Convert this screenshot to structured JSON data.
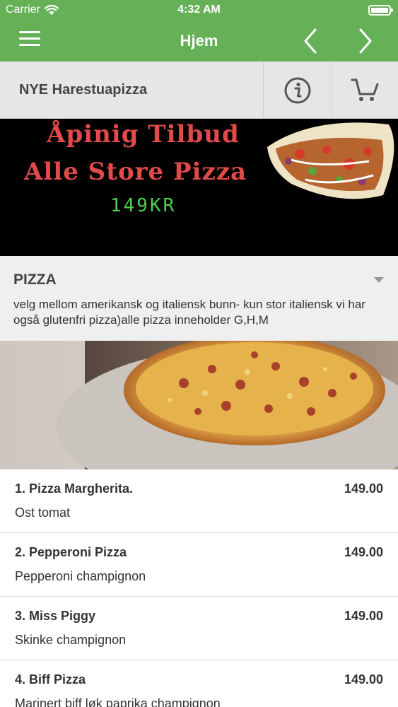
{
  "status_bar": {
    "carrier": "Carrier",
    "time": "4:32 AM"
  },
  "navbar": {
    "title": "Hjem"
  },
  "restaurant": {
    "name": "NYE Harestuapizza"
  },
  "banner": {
    "line1": "Åpinig Tilbud",
    "line2": "Alle Store Pizza",
    "price": "149KR"
  },
  "category": {
    "title": "PIZZA",
    "description": "velg mellom amerikansk og italiensk bunn- kun stor italiensk vi har også glutenfri pizza)alle pizza inneholder G,H,M"
  },
  "menu_items": [
    {
      "name": "1. Pizza Margherita.",
      "price": "149.00",
      "description": "Ost tomat"
    },
    {
      "name": "2. Pepperoni Pizza",
      "price": "149.00",
      "description": "Pepperoni champignon"
    },
    {
      "name": "3. Miss Piggy",
      "price": "149.00",
      "description": "Skinke champignon"
    },
    {
      "name": "4. Biff Pizza",
      "price": "149.00",
      "description": "Marinert biff løk paprika champignon"
    }
  ],
  "colors": {
    "nav_green": "#66b158",
    "banner_red": "#e24a4a",
    "banner_green": "#4fd14f"
  },
  "icons": [
    "wifi-icon",
    "battery-icon",
    "hamburger-menu-icon",
    "chevron-left-icon",
    "chevron-right-icon",
    "info-icon",
    "cart-icon",
    "dropdown-arrow-icon"
  ]
}
